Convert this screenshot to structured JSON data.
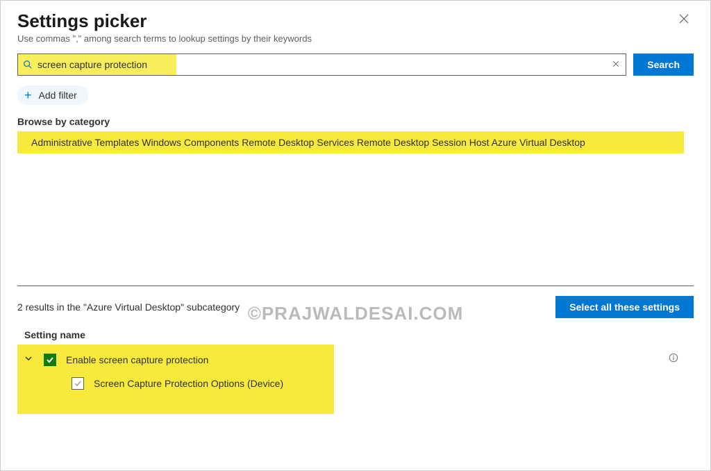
{
  "header": {
    "title": "Settings picker",
    "subtitle": "Use commas \",\" among search terms to lookup settings by their keywords"
  },
  "search": {
    "value": "screen capture protection",
    "button_label": "Search"
  },
  "filter": {
    "add_label": "Add filter"
  },
  "browse": {
    "label": "Browse by category",
    "breadcrumb": "Administrative Templates Windows Components Remote Desktop Services Remote Desktop Session Host Azure Virtual Desktop"
  },
  "results": {
    "summary": "2 results in the \"Azure Virtual Desktop\" subcategory",
    "select_all_label": "Select all these settings",
    "column_header": "Setting name",
    "items": [
      {
        "label": "Enable screen capture protection",
        "checked": true
      },
      {
        "label": "Screen Capture Protection Options (Device)",
        "checked": false
      }
    ]
  },
  "watermark": "©PRAJWALDESAI.COM"
}
